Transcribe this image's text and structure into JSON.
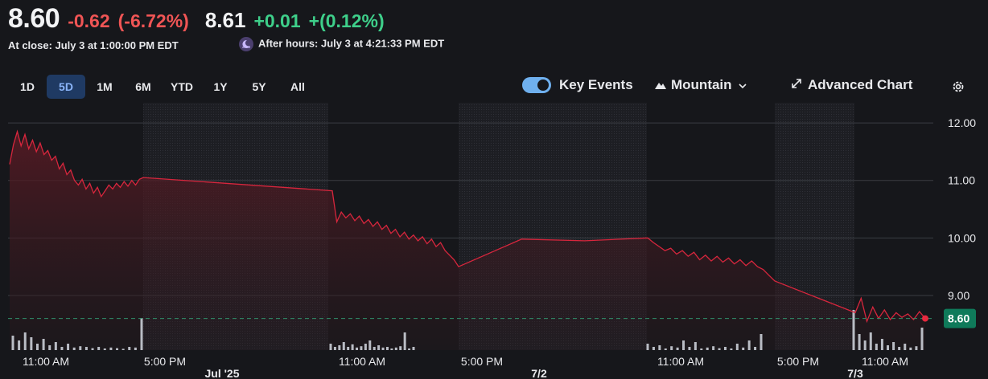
{
  "quote": {
    "price": "8.60",
    "change": "-0.62",
    "change_pct": "(-6.72%)",
    "ah_price": "8.61",
    "ah_change": "+0.01",
    "ah_change_pct": "+(0.12%)",
    "close_label": "At close: July 3 at 1:00:00 PM EDT",
    "ah_label": "After hours: July 3 at 4:21:33 PM EDT",
    "ah_icon": "moon-icon"
  },
  "ranges": [
    "1D",
    "5D",
    "1M",
    "6M",
    "YTD",
    "1Y",
    "5Y",
    "All"
  ],
  "active_range": "5D",
  "toolbar": {
    "key_events": "Key Events",
    "mountain": "Mountain",
    "advanced": "Advanced Chart",
    "settings_icon": "gear-icon",
    "expand_icon": "expand-icon",
    "mountain_icon": "mountain-icon",
    "chevron_icon": "chevron-down-icon"
  },
  "colors": {
    "line": "#d7263d",
    "current_badge": "#0f7a5a",
    "volume": "#b9bcc4",
    "active_range_bg": "#1f3a63"
  },
  "chart_data": {
    "type": "area",
    "ylim": [
      8.05,
      12.35
    ],
    "yticks": [
      9.0,
      10.0,
      11.0,
      12.0
    ],
    "ytick_labels": [
      "9.00",
      "10.00",
      "11.00",
      "12.00"
    ],
    "current_value": 8.6,
    "current_label": "8.60",
    "x_ticks": [
      "11:00 AM",
      "5:00 PM",
      "11:00 AM",
      "5:00 PM",
      "11:00 AM",
      "5:00 PM",
      "11:00 AM"
    ],
    "date_labels": [
      "Jul '25",
      "7/2",
      "7/3"
    ],
    "sessions": [
      {
        "name": "day1",
        "prices": [
          11.28,
          11.62,
          11.85,
          11.6,
          11.8,
          11.55,
          11.7,
          11.5,
          11.65,
          11.45,
          11.52,
          11.35,
          11.42,
          11.2,
          11.3,
          11.1,
          11.18,
          11.0,
          10.92,
          11.02,
          10.85,
          10.95,
          10.78,
          10.88,
          10.72,
          10.82,
          10.92,
          10.85,
          10.95,
          10.88,
          10.98,
          10.9,
          11.0,
          10.92,
          11.02,
          11.05
        ]
      },
      {
        "name": "day1-extended",
        "prices": [
          11.05,
          10.82
        ]
      },
      {
        "name": "day2",
        "prices": [
          10.82,
          10.28,
          10.45,
          10.35,
          10.42,
          10.3,
          10.38,
          10.25,
          10.32,
          10.2,
          10.28,
          10.15,
          10.22,
          10.08,
          10.15,
          10.02,
          10.1,
          9.98,
          10.05,
          9.95,
          10.02,
          9.9,
          9.98,
          9.85,
          9.92,
          9.78,
          9.7,
          9.62,
          9.5
        ]
      },
      {
        "name": "day2-extended",
        "prices": [
          9.5,
          9.98,
          9.95,
          10.0
        ]
      },
      {
        "name": "day3",
        "prices": [
          10.0,
          9.92,
          9.85,
          9.78,
          9.82,
          9.72,
          9.78,
          9.68,
          9.75,
          9.62,
          9.7,
          9.6,
          9.68,
          9.58,
          9.65,
          9.55,
          9.62,
          9.52,
          9.6,
          9.5,
          9.45,
          9.35,
          9.25
        ]
      },
      {
        "name": "day3-extended",
        "prices": [
          9.25,
          8.7
        ]
      },
      {
        "name": "day4",
        "prices": [
          8.7,
          8.95,
          8.55,
          8.8,
          8.6,
          8.75,
          8.58,
          8.7,
          8.62,
          8.68,
          8.58,
          8.72,
          8.6
        ]
      }
    ],
    "volumes": {
      "day1": [
        0.45,
        0.3,
        0.55,
        0.4,
        0.2,
        0.35,
        0.15,
        0.25,
        0.1,
        0.2,
        0.08,
        0.12,
        0.1,
        0.06,
        0.1,
        0.05,
        0.08,
        0.06,
        0.04,
        0.1,
        0.08,
        1.0
      ],
      "day2": [
        0.2,
        0.1,
        0.15,
        0.25,
        0.1,
        0.18,
        0.08,
        0.12,
        0.2,
        0.3,
        0.1,
        0.15,
        0.08,
        0.1,
        0.05,
        0.08,
        0.12,
        0.55,
        0.05,
        0.1
      ],
      "day3": [
        0.2,
        0.1,
        0.15,
        0.05,
        0.12,
        0.08,
        0.3,
        0.1,
        0.25,
        0.05,
        0.08,
        0.12,
        0.06,
        0.1,
        0.05,
        0.2,
        0.08,
        0.3,
        0.1,
        0.5
      ],
      "day4": [
        1.25,
        0.5,
        0.3,
        0.55,
        0.2,
        0.35,
        0.15,
        0.25,
        0.1,
        0.2,
        0.08,
        0.12,
        0.7
      ]
    }
  }
}
